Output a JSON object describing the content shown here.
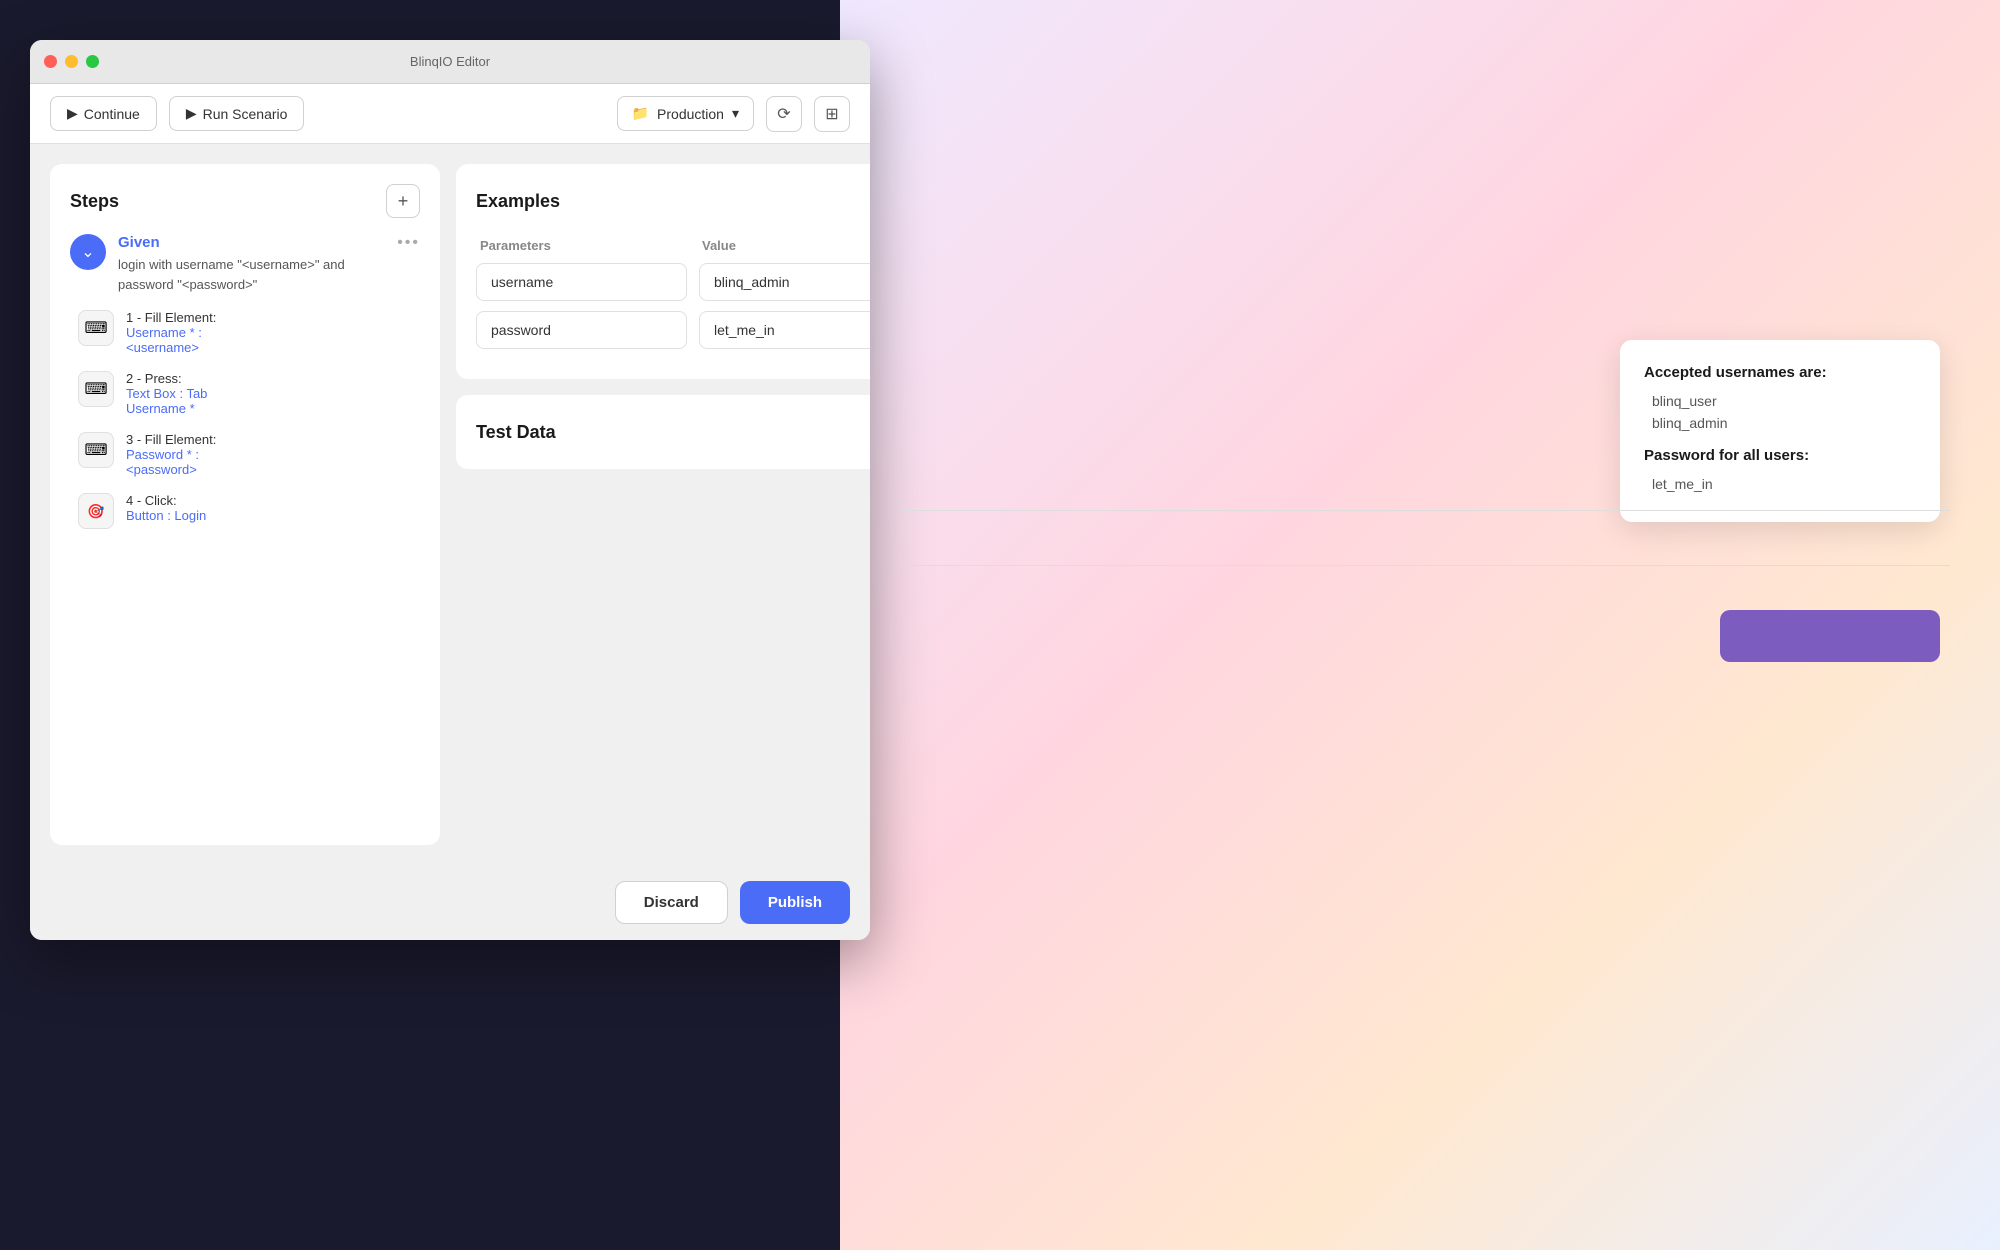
{
  "window": {
    "title": "BlinqIO Editor"
  },
  "traffic_lights": {
    "close": "close",
    "minimize": "minimize",
    "maximize": "maximize"
  },
  "toolbar": {
    "continue_label": "Continue",
    "run_scenario_label": "Run Scenario",
    "production_label": "Production",
    "continue_icon": "▶",
    "refresh_icon": "⟳",
    "layout_icon": "⊞"
  },
  "steps_panel": {
    "title": "Steps",
    "add_icon": "+",
    "given": {
      "label": "Given",
      "text": "login with username \"<username>\" and password \"<password>\"",
      "chevron": "⌄",
      "more_icon": "..."
    },
    "steps": [
      {
        "number": "1",
        "action": "1 - Fill Element:",
        "target_line1": "Username * :",
        "target_line2": "<username>",
        "icon": "⌨"
      },
      {
        "number": "2",
        "action": "2 - Press:",
        "target_line1": "Text Box : Tab",
        "target_line2": "Username *",
        "icon": "⌨"
      },
      {
        "number": "3",
        "action": "3 - Fill Element:",
        "target_line1": "Password * :",
        "target_line2": "<password>",
        "icon": "⌨"
      },
      {
        "number": "4",
        "action": "4 - Click:",
        "target_line1": "Button : Login",
        "target_line2": "",
        "icon": "🎯"
      }
    ]
  },
  "examples": {
    "title": "Examples",
    "add_icon": "+",
    "columns": {
      "parameters": "Parameters",
      "value": "Value"
    },
    "rows": [
      {
        "param": "username",
        "value": "blinq_admin"
      },
      {
        "param": "password",
        "value": "let_me_in"
      }
    ]
  },
  "test_data": {
    "title": "Test Data",
    "chevron": "⌄"
  },
  "footer": {
    "discard_label": "Discard",
    "publish_label": "Publish"
  },
  "tooltip": {
    "title": "Accepted usernames are:",
    "usernames": [
      "blinq_user",
      "blinq_admin"
    ],
    "password_title": "Password for all users:",
    "password": "let_me_in"
  },
  "colors": {
    "primary_blue": "#4a6cf7",
    "link_blue": "#4a6cf7",
    "traffic_close": "#ff5f57",
    "traffic_min": "#febc2e",
    "traffic_max": "#28c840"
  }
}
